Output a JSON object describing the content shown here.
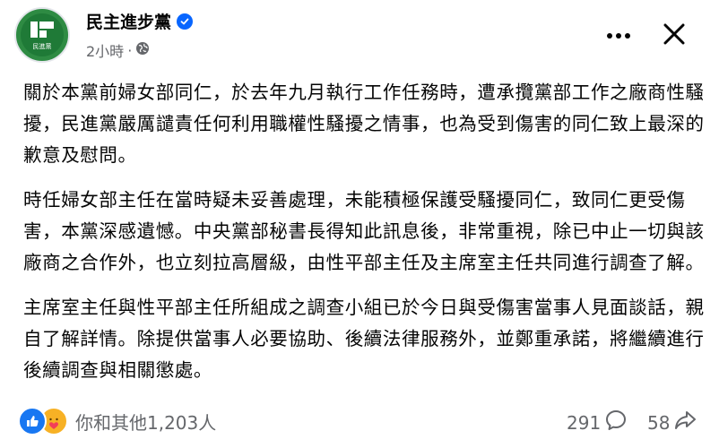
{
  "post": {
    "page_name": "民主進步黨",
    "avatar_text": "民進黨",
    "time": "2小時",
    "separator": "·",
    "paragraphs": [
      "關於本黨前婦女部同仁，於去年九月執行工作任務時，遭承攬黨部工作之廠商性騷擾，民進黨嚴厲譴責任何利用職權性騷擾之情事，也為受到傷害的同仁致上最深的歉意及慰問。",
      "時任婦女部主任在當時疑未妥善處理，未能積極保護受騷擾同仁，致同仁更受傷害，本黨深感遺憾。中央黨部秘書長得知此訊息後，非常重視，除已中止一切與該廠商之合作外，也立刻拉高層級，由性平部主任及主席室主任共同進行調查了解。",
      "主席室主任與性平部主任所組成之調查小組已於今日與受傷害當事人見面談話，親自了解詳情。除提供當事人必要協助、後續法律服務外，並鄭重承諾，將繼續進行後續調查與相關懲處。"
    ]
  },
  "footer": {
    "reactions_text": "你和其他1,203人",
    "comments_count": "291",
    "shares_count": "58"
  },
  "icons": {
    "verified": "verified-badge-icon",
    "privacy": "globe-icon",
    "more": "more-horizontal-icon",
    "close": "close-icon",
    "like": "like-reaction-icon",
    "care": "care-reaction-icon",
    "comment": "comment-icon",
    "share": "share-icon"
  },
  "colors": {
    "verified_blue": "#0866ff",
    "secondary_text": "#65676b",
    "brand_green": "#2e8b43"
  }
}
